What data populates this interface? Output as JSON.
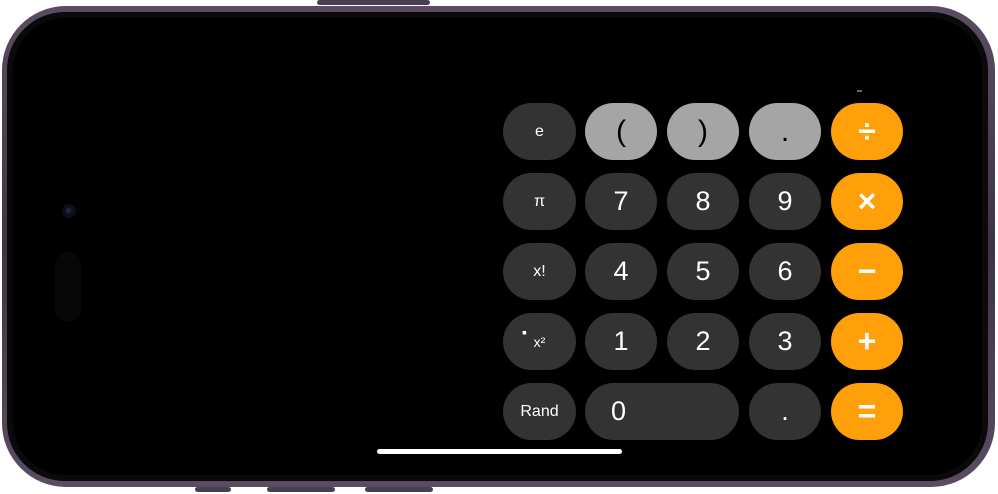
{
  "calculator": {
    "keys": {
      "e": "e",
      "open_paren": "(",
      "close_paren": ")",
      "dot_top": ".",
      "divide": "÷",
      "pi": "π",
      "seven": "7",
      "eight": "8",
      "nine": "9",
      "multiply": "×",
      "factorial": "x!",
      "four": "4",
      "five": "5",
      "six": "6",
      "minus": "−",
      "square_dot": "▪",
      "square": "x²",
      "one": "1",
      "two": "2",
      "three": "3",
      "plus": "+",
      "rand": "Rand",
      "zero": "0",
      "decimal": ".",
      "equals": "="
    }
  },
  "colors": {
    "operator": "#ff9f0a",
    "function_gray": "#a5a5a5",
    "number_dark": "#333333",
    "screen": "#000000"
  }
}
